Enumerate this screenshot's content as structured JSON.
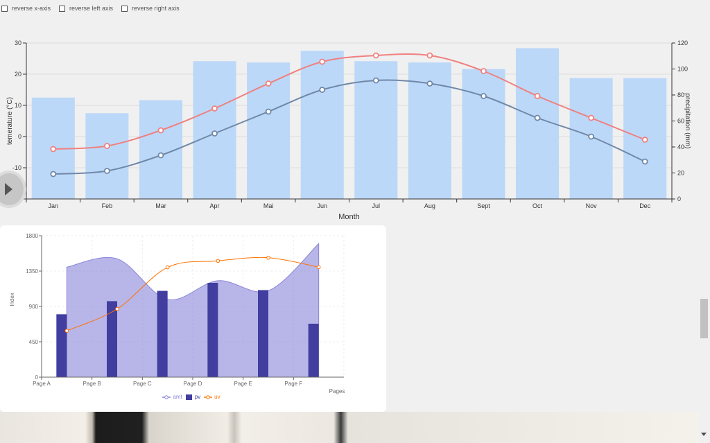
{
  "controls": [
    {
      "label": "reverse x-axis",
      "checked": false
    },
    {
      "label": "reverse left axis",
      "checked": false
    },
    {
      "label": "reverse right axis",
      "checked": false
    }
  ],
  "chart_data": [
    {
      "type": "bar+line",
      "categories": [
        "Jan",
        "Feb",
        "Mar",
        "Apr",
        "Mai",
        "Jun",
        "Jul",
        "Aug",
        "Sept",
        "Oct",
        "Nov",
        "Dec"
      ],
      "xlabel": "Month",
      "ylabel": "temerature (°C)",
      "y2label": "precipitation (mm)",
      "ylim": [
        -20,
        30
      ],
      "yticks": [
        -20,
        -10,
        0,
        10,
        20,
        30
      ],
      "y2lim": [
        0,
        120
      ],
      "y2ticks": [
        0,
        20,
        40,
        60,
        80,
        100,
        120
      ],
      "grid": true,
      "series": [
        {
          "kind": "bar",
          "axis": "right",
          "color": "#bcd8f8",
          "values": [
            78,
            66,
            76,
            106,
            105,
            114,
            106,
            105,
            100,
            116,
            93,
            93
          ]
        },
        {
          "kind": "line",
          "axis": "left",
          "color": "#f08080",
          "values": [
            -4,
            -3,
            2,
            9,
            17,
            24,
            26,
            26,
            21,
            13,
            6,
            -1
          ]
        },
        {
          "kind": "line",
          "axis": "left",
          "color": "#7088a8",
          "values": [
            -12,
            -11,
            -6,
            1,
            8,
            15,
            18,
            17,
            13,
            6,
            0,
            -8
          ]
        }
      ]
    },
    {
      "type": "composed",
      "categories": [
        "Page A",
        "Page B",
        "Page C",
        "Page D",
        "Page E",
        "Page F"
      ],
      "xlabel": "Pages",
      "ylabel": "Index",
      "ylim": [
        0,
        1800
      ],
      "yticks": [
        0,
        450,
        900,
        1350,
        1800
      ],
      "grid": true,
      "x": [
        0.5,
        1.5,
        2.5,
        3.5,
        4.5,
        5.5
      ],
      "series": [
        {
          "name": "amt",
          "kind": "area",
          "color": "#8884d8",
          "values": [
            1400,
            1506,
            989,
            1228,
            1100,
            1700
          ]
        },
        {
          "name": "pv",
          "kind": "bar",
          "color": "#413ea0",
          "values": [
            800,
            967,
            1098,
            1200,
            1108,
            680
          ]
        },
        {
          "name": "uv",
          "kind": "line",
          "color": "#ff7300",
          "values": [
            590,
            868,
            1397,
            1480,
            1520,
            1400
          ]
        }
      ]
    }
  ]
}
